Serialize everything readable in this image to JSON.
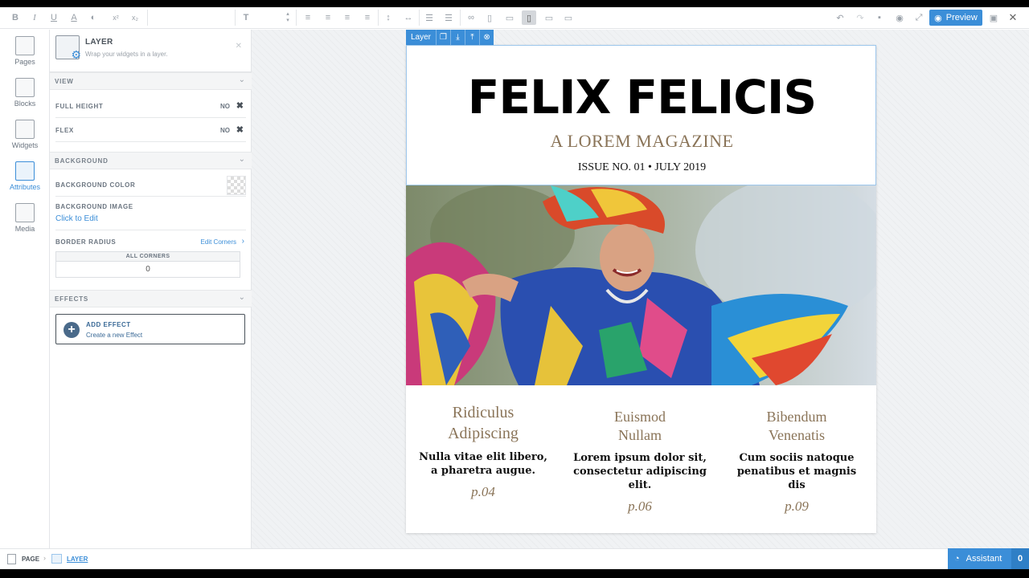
{
  "toolbar": {
    "preview_label": "Preview"
  },
  "rail": {
    "items": [
      {
        "label": "Pages"
      },
      {
        "label": "Blocks"
      },
      {
        "label": "Widgets"
      },
      {
        "label": "Attributes"
      },
      {
        "label": "Media"
      }
    ]
  },
  "panel": {
    "title": "LAYER",
    "subtitle": "Wrap your widgets in a layer.",
    "sections": {
      "view": "VIEW",
      "background": "BACKGROUND",
      "effects": "EFFECTS"
    },
    "full_height": {
      "label": "FULL HEIGHT",
      "value": "NO"
    },
    "flex": {
      "label": "FLEX",
      "value": "NO"
    },
    "background_color": {
      "label": "BACKGROUND COLOR"
    },
    "background_image": {
      "label": "BACKGROUND IMAGE",
      "link": "Click to Edit"
    },
    "border_radius": {
      "label": "BORDER RADIUS",
      "link": "Edit Corners",
      "corners_label": "ALL CORNERS",
      "corners_value": "0"
    },
    "add_effect": {
      "title": "ADD EFFECT",
      "subtitle": "Create a new Effect"
    }
  },
  "canvas": {
    "layer_tag": "Layer",
    "magazine": {
      "title": "FELIX FELICIS",
      "subtitle": "A LOREM MAGAZINE",
      "issue": "ISSUE NO. 01 • JULY 2019"
    },
    "columns": [
      {
        "heading_1": "Ridiculus",
        "heading_2": "Adipiscing",
        "text": "Nulla vitae elit libero, a pharetra augue.",
        "page": "p.04"
      },
      {
        "heading_1": "Euismod",
        "heading_2": "Nullam",
        "text": "Lorem ipsum dolor sit, consectetur adipiscing elit.",
        "page": "p.06"
      },
      {
        "heading_1": "Bibendum",
        "heading_2": "Venenatis",
        "text": "Cum sociis natoque penatibus et magnis dis",
        "page": "p.09"
      }
    ]
  },
  "bottombar": {
    "breadcrumb_page": "PAGE",
    "breadcrumb_layer": "LAYER",
    "assistant_label": "Assistant",
    "assistant_count": "0"
  },
  "colors": {
    "accent": "#3b8ed8",
    "magazine_gold": "#8a7458"
  }
}
